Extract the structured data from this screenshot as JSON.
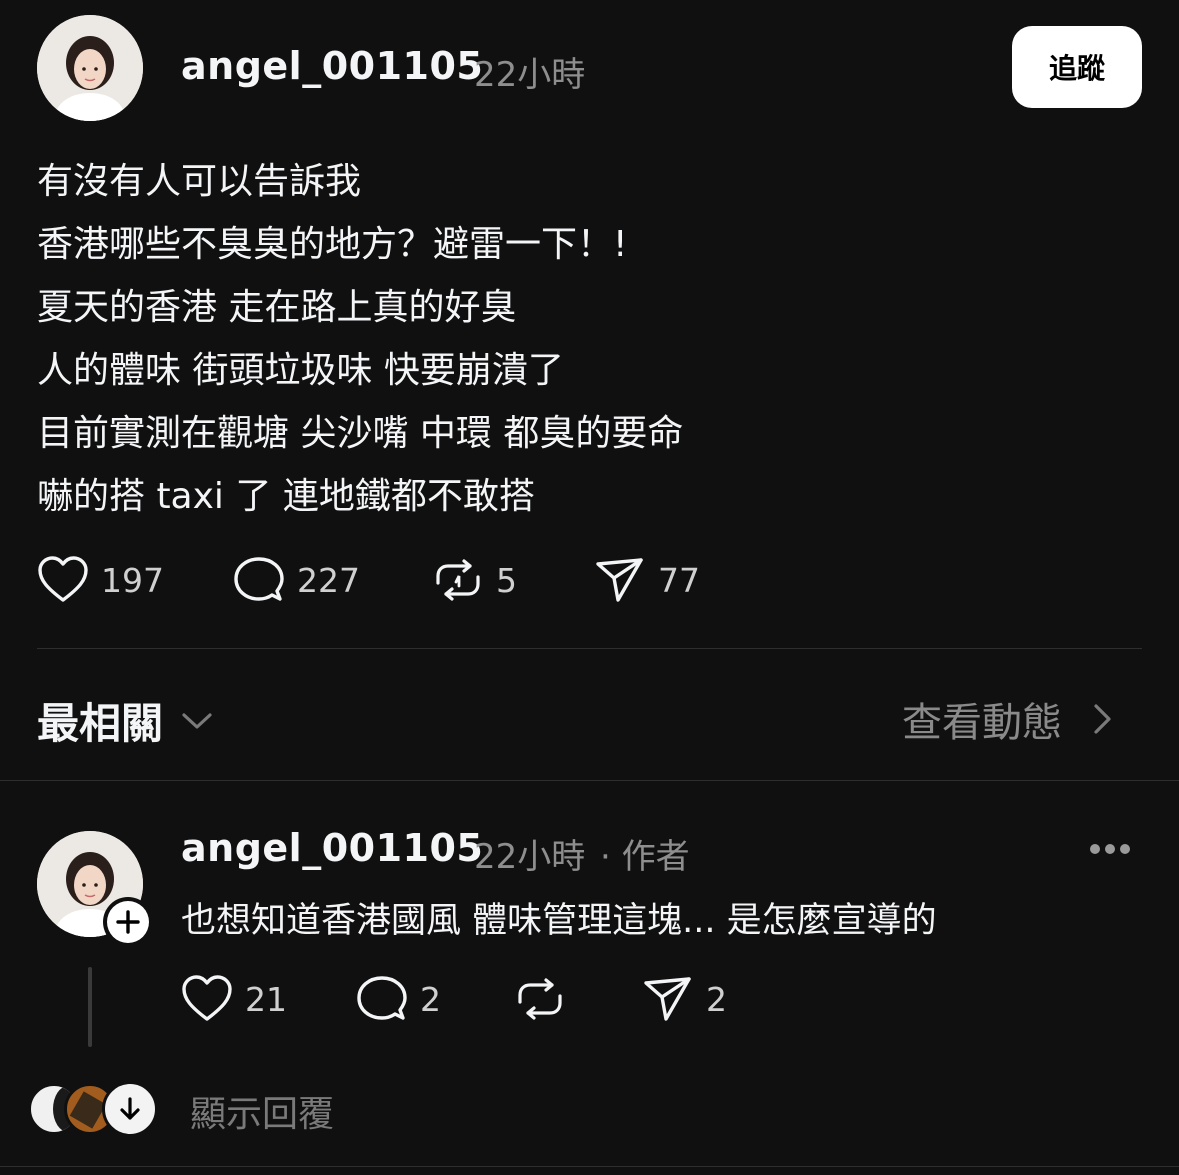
{
  "post": {
    "username": "angel_001105",
    "time": "22小時",
    "follow_label": "追蹤",
    "lines": [
      "有沒有人可以告訴我",
      "香港哪些不臭臭的地方？避雷一下！!",
      "夏天的香港 走在路上真的好臭",
      "人的體味 街頭垃圾味 快要崩潰了",
      "目前實測在觀塘 尖沙嘴 中環 都臭的要命",
      "嚇的搭 taxi 了 連地鐵都不敢搭"
    ],
    "likes": "197",
    "comments": "227",
    "reposts": "5",
    "shares": "77"
  },
  "sort": {
    "label": "最相關",
    "activity_label": "查看動態"
  },
  "reply": {
    "username": "angel_001105",
    "time": "22小時",
    "author_tag": "· 作者",
    "text": "也想知道香港國風 體味管理這塊... 是怎麼宣導的",
    "likes": "21",
    "comments": "2",
    "shares": "2",
    "show_replies": "顯示回覆"
  },
  "colors": {
    "background": "#101010",
    "text": "#f3f5f7",
    "secondary": "#8e8e8e",
    "follow_button": "#ffffff"
  },
  "icons": [
    "heart-icon",
    "comment-icon",
    "repost-icon",
    "share-icon",
    "chevron-down-icon",
    "chevron-right-icon",
    "more-icon",
    "plus-icon",
    "arrow-down-icon"
  ]
}
